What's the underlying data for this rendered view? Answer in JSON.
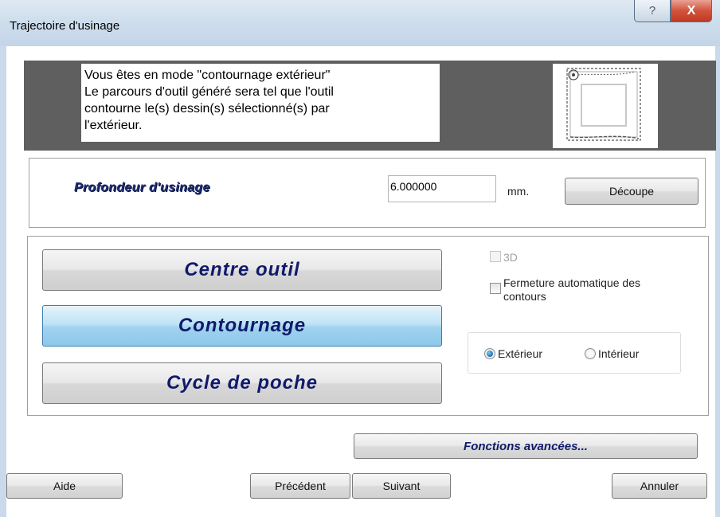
{
  "window": {
    "title": "Trajectoire d'usinage",
    "help_label": "?",
    "close_label": "X"
  },
  "info": {
    "lines": [
      "Vous êtes en mode \"contournage extérieur\"",
      "Le parcours d'outil généré sera tel que l'outil",
      "contourne le(s) dessin(s) sélectionné(s) par",
      "l'extérieur."
    ]
  },
  "depth": {
    "label": "Profondeur d'usinage",
    "value": "6.000000",
    "unit": "mm.",
    "button_label": "Découpe"
  },
  "modes": {
    "centre": "Centre outil",
    "contournage": "Contournage",
    "poche": "Cycle de poche",
    "selected": "Contournage"
  },
  "options": {
    "three_d_label": "3D",
    "fermeture_line1": "Fermeture automatique des",
    "fermeture_line2": "contours",
    "exterieur_label": "Extérieur",
    "interieur_label": "Intérieur",
    "selected_side": "Extérieur"
  },
  "buttons": {
    "advanced": "Fonctions avancées...",
    "aide": "Aide",
    "precedent": "Précédent",
    "suivant": "Suivant",
    "annuler": "Annuler"
  },
  "colors": {
    "accent_text": "#101a6a",
    "active_button": "#9fd2ef",
    "banner_bg": "#5f5f5f"
  }
}
